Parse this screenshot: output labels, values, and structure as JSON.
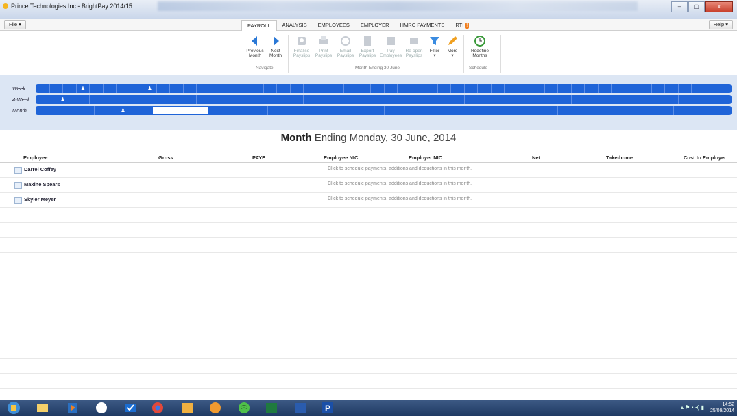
{
  "window": {
    "title": "Prince Technologies Inc - BrightPay 2014/15",
    "controls": {
      "minimize": "–",
      "maximize": "▢",
      "close": "x"
    }
  },
  "menubar": {
    "file_label": "File ▾",
    "help_label": "Help ▾"
  },
  "tabs": [
    {
      "label": "PAYROLL",
      "active": true
    },
    {
      "label": "ANALYSIS",
      "active": false
    },
    {
      "label": "EMPLOYEES",
      "active": false
    },
    {
      "label": "EMPLOYER",
      "active": false
    },
    {
      "label": "HMRC PAYMENTS",
      "active": false
    },
    {
      "label": "RTI",
      "active": false,
      "badge": "!"
    }
  ],
  "ribbon": {
    "navigate": {
      "group_label": "Navigate",
      "previous": {
        "line1": "Previous",
        "line2": "Month",
        "icon": "arrow-left-icon"
      },
      "next": {
        "line1": "Next",
        "line2": "Month",
        "icon": "arrow-right-icon"
      }
    },
    "month_group": {
      "group_label": "Month Ending 30 June",
      "finalise": {
        "line1": "Finalise",
        "line2": "Payslips"
      },
      "print": {
        "line1": "Print",
        "line2": "Payslips"
      },
      "email": {
        "line1": "Email",
        "line2": "Payslips"
      },
      "export": {
        "line1": "Export",
        "line2": "Payslips"
      },
      "pay": {
        "line1": "Pay",
        "line2": "Employees"
      },
      "reopen": {
        "line1": "Re-open",
        "line2": "Payslips"
      },
      "filter": {
        "line1": "Filter",
        "line2": "▾"
      },
      "more": {
        "line1": "More",
        "line2": "▾"
      }
    },
    "schedule": {
      "group_label": "Schedule",
      "redefine": {
        "line1": "Redefine",
        "line2": "Months"
      }
    }
  },
  "calendar": {
    "labels": {
      "week": "Week",
      "four_week": "4-Week",
      "month": "Month"
    }
  },
  "heading": {
    "bold": "Month",
    "rest": " Ending Monday, 30 June, 2014"
  },
  "table": {
    "headers": {
      "employee": "Employee",
      "gross": "Gross",
      "paye": "PAYE",
      "employee_nic": "Employee NIC",
      "employer_nic": "Employer NIC",
      "net": "Net",
      "take_home": "Take-home",
      "cost": "Cost to Employer"
    },
    "hint": "Click to schedule payments, additions and deductions in this month.",
    "employees": [
      "Darrel Coffey",
      "Maxine Spears",
      "Skyler Meyer"
    ]
  },
  "taskbar": {
    "time": "14:52",
    "date": "25/09/2014"
  },
  "colors": {
    "calendar_blue": "#1f64d8",
    "rti_badge": "#f07d1b"
  }
}
